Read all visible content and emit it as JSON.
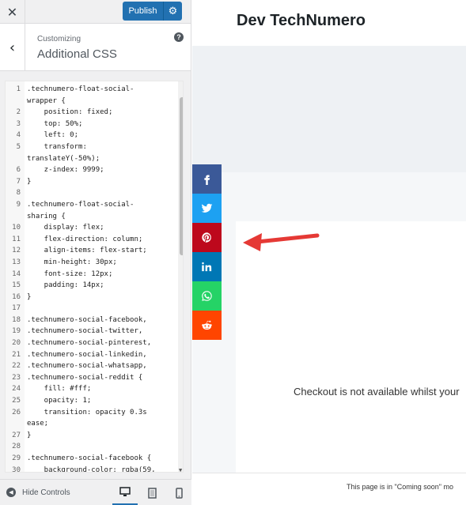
{
  "panel": {
    "close_glyph": "✕",
    "publish_label": "Publish",
    "customizing_label": "Customizing",
    "section_heading": "Additional CSS",
    "help_glyph": "?",
    "back_glyph": "‹"
  },
  "code_lines": [
    {
      "n": "1",
      "t": ".technumero-float-social-"
    },
    {
      "n": "",
      "t": "wrapper {"
    },
    {
      "n": "2",
      "t": "    position: fixed;"
    },
    {
      "n": "3",
      "t": "    top: 50%;"
    },
    {
      "n": "4",
      "t": "    left: 0;"
    },
    {
      "n": "5",
      "t": "    transform:"
    },
    {
      "n": "",
      "t": "translateY(-50%);"
    },
    {
      "n": "6",
      "t": "    z-index: 9999;"
    },
    {
      "n": "7",
      "t": "}"
    },
    {
      "n": "8",
      "t": ""
    },
    {
      "n": "9",
      "t": ".technumero-float-social-"
    },
    {
      "n": "",
      "t": "sharing {"
    },
    {
      "n": "10",
      "t": "    display: flex;"
    },
    {
      "n": "11",
      "t": "    flex-direction: column;"
    },
    {
      "n": "12",
      "t": "    align-items: flex-start;"
    },
    {
      "n": "13",
      "t": "    min-height: 30px;"
    },
    {
      "n": "14",
      "t": "    font-size: 12px;"
    },
    {
      "n": "15",
      "t": "    padding: 14px;"
    },
    {
      "n": "16",
      "t": "}"
    },
    {
      "n": "17",
      "t": ""
    },
    {
      "n": "18",
      "t": ".technumero-social-facebook,"
    },
    {
      "n": "19",
      "t": ".technumero-social-twitter,"
    },
    {
      "n": "20",
      "t": ".technumero-social-pinterest,"
    },
    {
      "n": "21",
      "t": ".technumero-social-linkedin,"
    },
    {
      "n": "22",
      "t": ".technumero-social-whatsapp,"
    },
    {
      "n": "23",
      "t": ".technumero-social-reddit {"
    },
    {
      "n": "24",
      "t": "    fill: #fff;"
    },
    {
      "n": "25",
      "t": "    opacity: 1;"
    },
    {
      "n": "26",
      "t": "    transition: opacity 0.3s"
    },
    {
      "n": "",
      "t": "ease;"
    },
    {
      "n": "27",
      "t": "}"
    },
    {
      "n": "28",
      "t": ""
    },
    {
      "n": "29",
      "t": ".technumero-social-facebook {"
    },
    {
      "n": "30",
      "t": "    background-color: rgba(59,"
    }
  ],
  "footer": {
    "hide_controls_label": "Hide Controls",
    "devices": [
      "desktop-icon",
      "tablet-icon",
      "mobile-icon"
    ]
  },
  "preview": {
    "site_title": "Dev TechNumero",
    "checkout_text": "Checkout is not available whilst your",
    "footer_text": "This page is in \"Coming soon\" mo"
  },
  "social": [
    {
      "name": "facebook",
      "color": "#3b5998"
    },
    {
      "name": "twitter",
      "color": "#1da1f2"
    },
    {
      "name": "pinterest",
      "color": "#bd081c"
    },
    {
      "name": "linkedin",
      "color": "#0077b5"
    },
    {
      "name": "whatsapp",
      "color": "#25d366"
    },
    {
      "name": "reddit",
      "color": "#ff4500"
    }
  ],
  "colors": {
    "accent": "#2271b1",
    "arrow": "#e53935"
  }
}
